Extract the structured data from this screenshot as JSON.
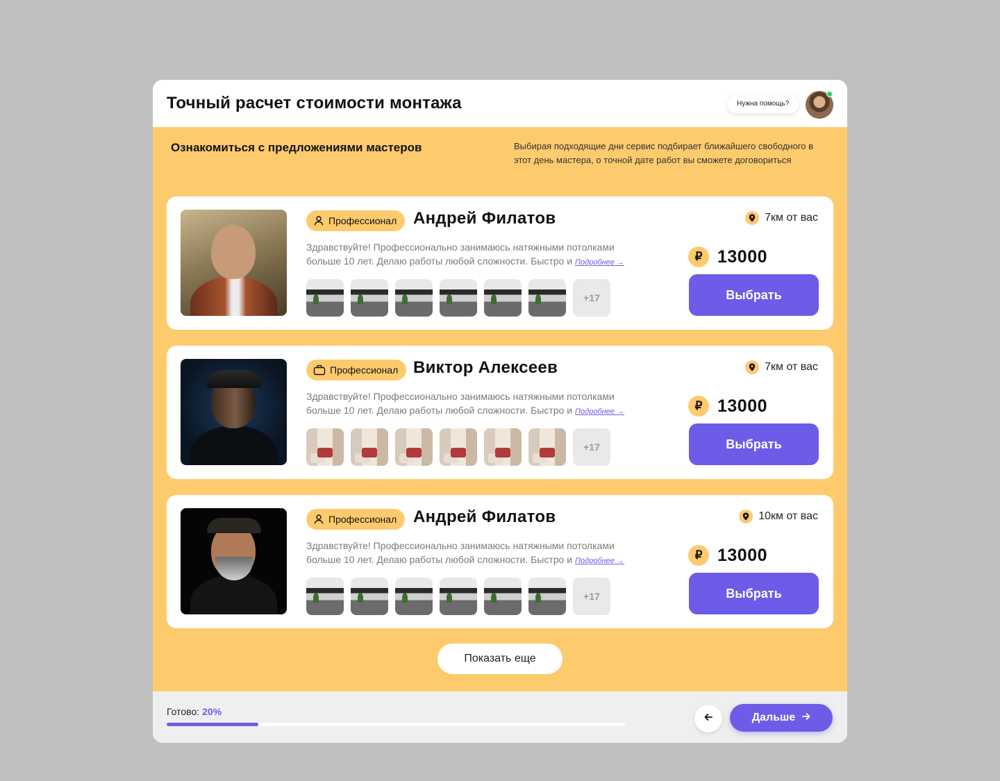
{
  "header": {
    "title": "Точный расчет стоимости монтажа",
    "help_label": "Нужна помощь?",
    "support_avatar_icon": "support-avatar",
    "online_color": "#2ed25c"
  },
  "section": {
    "title": "Ознакомиться с предложениями мастеров",
    "description": "Выбирая подходящие дни сервис подбирает ближайшего свободного в этот день мастера, о точной дате работ вы сможете договориться"
  },
  "colors": {
    "accent": "#6c5ce7",
    "yellow": "#fdcb6e"
  },
  "masters": [
    {
      "badge_icon": "user-icon",
      "badge": "Профессионал",
      "name": "Андрей Филатов",
      "description": "Здравствуйте! Профессионально занимаюсь натяжными потолками больше 10 лет. Делаю работы любой сложности. Быстро и",
      "more_link": "Подробнее →",
      "more_photos": "+17",
      "distance": "7км от вас",
      "currency": "₽",
      "price": "13000",
      "select_label": "Выбрать"
    },
    {
      "badge_icon": "briefcase-icon",
      "badge": "Профессионал",
      "name": "Виктор Алексеев",
      "description": "Здравствуйте! Профессионально занимаюсь натяжными потолками больше 10 лет. Делаю работы любой сложности. Быстро и",
      "more_link": "Подробнее →",
      "more_photos": "+17",
      "distance": "7км от вас",
      "currency": "₽",
      "price": "13000",
      "select_label": "Выбрать"
    },
    {
      "badge_icon": "user-icon",
      "badge": "Профессионал",
      "name": "Андрей Филатов",
      "description": "Здравствуйте! Профессионально занимаюсь натяжными потолками больше 10 лет. Делаю работы любой сложности. Быстро и",
      "more_link": "Подробнее →",
      "more_photos": "+17",
      "distance": "10км от вас",
      "currency": "₽",
      "price": "13000",
      "select_label": "Выбрать"
    }
  ],
  "show_more_label": "Показать еще",
  "footer": {
    "ready_label": "Готово:",
    "ready_value": "20%",
    "progress_fraction": 0.2,
    "back_icon": "arrow-left-icon",
    "next_label": "Дальше",
    "next_icon": "arrow-right-icon"
  }
}
